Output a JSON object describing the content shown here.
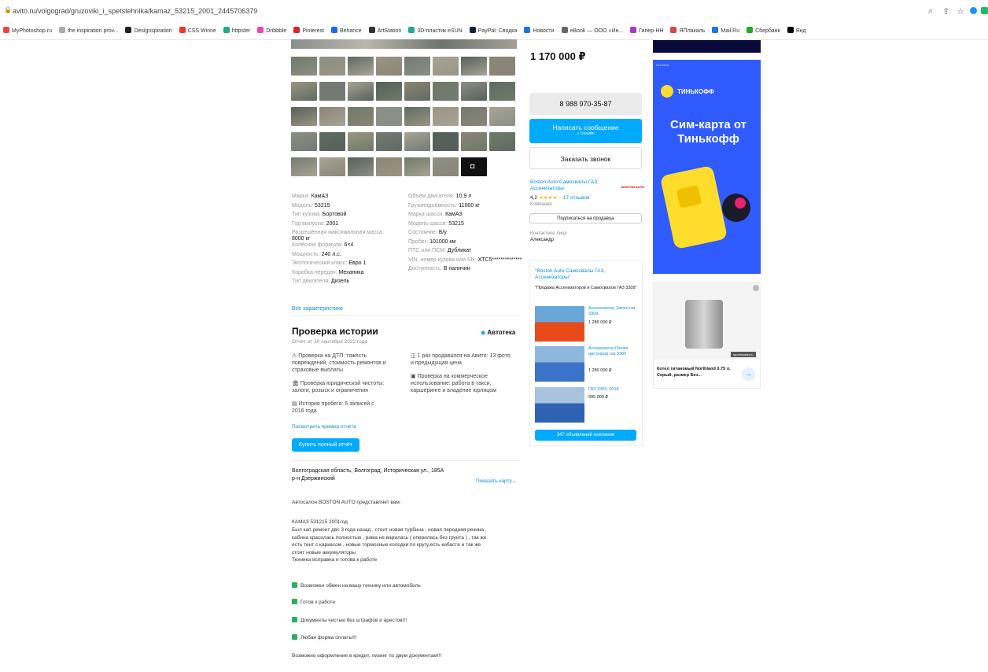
{
  "browser": {
    "url": "avito.ru/volgograd/gruzoviki_i_spetstehnika/kamaz_53215_2001_2445706379",
    "bookmarks": [
      "MyPhotoshop.ru",
      "the inspiration prov...",
      "Designspiration",
      "CSS Winne",
      "httpster",
      "Dribbble",
      "Pinterest",
      "Behance",
      "ArtStation",
      "3D-пластик eSUN",
      "PayPal: Сводка",
      "Новости",
      "eBook — ООО «Ин...",
      "Гипер-НН",
      "ЯПлакаль",
      "Mail.Ru",
      "Сбербанк",
      "Янд"
    ]
  },
  "listing": {
    "price": "1 170 000 ₽",
    "phone": "8 988 970-35-87",
    "write_message": "Написать сообщение",
    "online": "Онлайн",
    "order_call": "Заказать звонок",
    "seller_name": "Boston Auto Самосвалы ГАЗ, Ассенизаторы",
    "rating": "4,2",
    "reviews": "17 отзывов",
    "seller_type": "Компания",
    "subscribe": "Подписаться на продавца",
    "contact_label": "Контактное лицо",
    "contact_name": "Александр",
    "all_specs": "Все характеристики"
  },
  "specs_left": [
    {
      "k": "Марка:",
      "v": "КамАЗ"
    },
    {
      "k": "Модель:",
      "v": "53215"
    },
    {
      "k": "Тип кузова:",
      "v": "Бортовой"
    },
    {
      "k": "Год выпуска:",
      "v": "2001"
    },
    {
      "k": "Разрешённая максимальная масса:",
      "v": "8000 кг"
    },
    {
      "k": "Колёсная формула:",
      "v": "6×4"
    },
    {
      "k": "Мощность:",
      "v": "240 л.с."
    },
    {
      "k": "Экологический класс:",
      "v": "Евро 1"
    },
    {
      "k": "Коробка передач:",
      "v": "Механика"
    },
    {
      "k": "Тип двигателя:",
      "v": "Дизель"
    }
  ],
  "specs_right": [
    {
      "k": "Объём двигателя:",
      "v": "10.9 л"
    },
    {
      "k": "Грузоподъёмность:",
      "v": "11000 кг"
    },
    {
      "k": "Марка шасси:",
      "v": "КамАЗ"
    },
    {
      "k": "Модель шасси:",
      "v": "53215"
    },
    {
      "k": "Состояние:",
      "v": "Б/у"
    },
    {
      "k": "Пробег:",
      "v": "101000 км"
    },
    {
      "k": "ПТС или ПСМ:",
      "v": "Дубликат"
    },
    {
      "k": "VIN, номер кузова или SN:",
      "v": "XTC5**************"
    },
    {
      "k": "Доступность:",
      "v": "В наличии"
    }
  ],
  "history": {
    "title": "Проверка истории",
    "date": "Отчёт от 30 сентября 2022 года",
    "brand": "Автотека",
    "items_left": [
      "Проверка на ДТП: тяжесть повреждений, стоимость ремонтов и страховые выплаты",
      "Проверка юридической чистоты: залоги, розыск и ограничения",
      "История пробега: 5 записей с 2016 года"
    ],
    "items_right": [
      "1 раз продавался на Авито: 13 фото и предыдущая цена",
      "Проверка на коммерческое использование: работа в такси, каршеринге и владение юрлицом"
    ],
    "example_link": "Посмотреть пример отчёта",
    "buy_button": "Купить полный отчёт"
  },
  "address": {
    "line1": "Волгоградская область, Волгоград, Историческая ул., 185А",
    "line2": "р-н Дзержинский",
    "show_map": "Показать карту"
  },
  "description": {
    "intro": "Автосалон BOSTON AUTO представляет вам:",
    "model": "КАМАЗ 531215 2001год",
    "lines": [
      "Был кап ремонт двс 3 года назад , стоит новая турбина , новая передняя резина ,",
      "кабина красилась полностью , рама не варилась ( оперилась без грунта ) , так же",
      "есть тент с каркасом , новые тормозные колодки по кругу,есть кибаста и так же",
      "стоят новые аккумуляторы",
      "Техника исправна и готова к работе"
    ],
    "checks": [
      "Возможен обмен на вашу технику или автомобиль",
      "Готов к работе",
      "Документы чистые без штрафов и арестов!!!",
      "Любая форма оплаты!!!"
    ],
    "footer": "Возможно оформление в кредит, лизинг по двум документам!!!"
  },
  "seller_ads": {
    "title": "\"Boston Auto Самосвалы ГАЗ, Ассенизаторы\"",
    "subtitle": "\"Продажа Ассенизаторов и Самосвалов ГАЗ 3309\"",
    "items": [
      {
        "name": "Ассенизатор, Запчс газ 3309",
        "price": "1 280 000 ₽"
      },
      {
        "name": "Ассенизатор (бочка цистерна) газ 3309",
        "price": "1 280 000 ₽"
      },
      {
        "name": "ГАЗ 3309, 2018",
        "price": "995 000 ₽"
      }
    ],
    "all_button": "347 объявлений компании"
  },
  "ads": {
    "label": "Реклама",
    "tinkoff": "ТИНЬКОФФ",
    "tinkoff_headline": "Сим-карта от Тинькофф",
    "promo_title": "Котел титановый Northland 0.75 л, Серый, размер Без...",
    "promo_site": "sportmaster.ru"
  }
}
